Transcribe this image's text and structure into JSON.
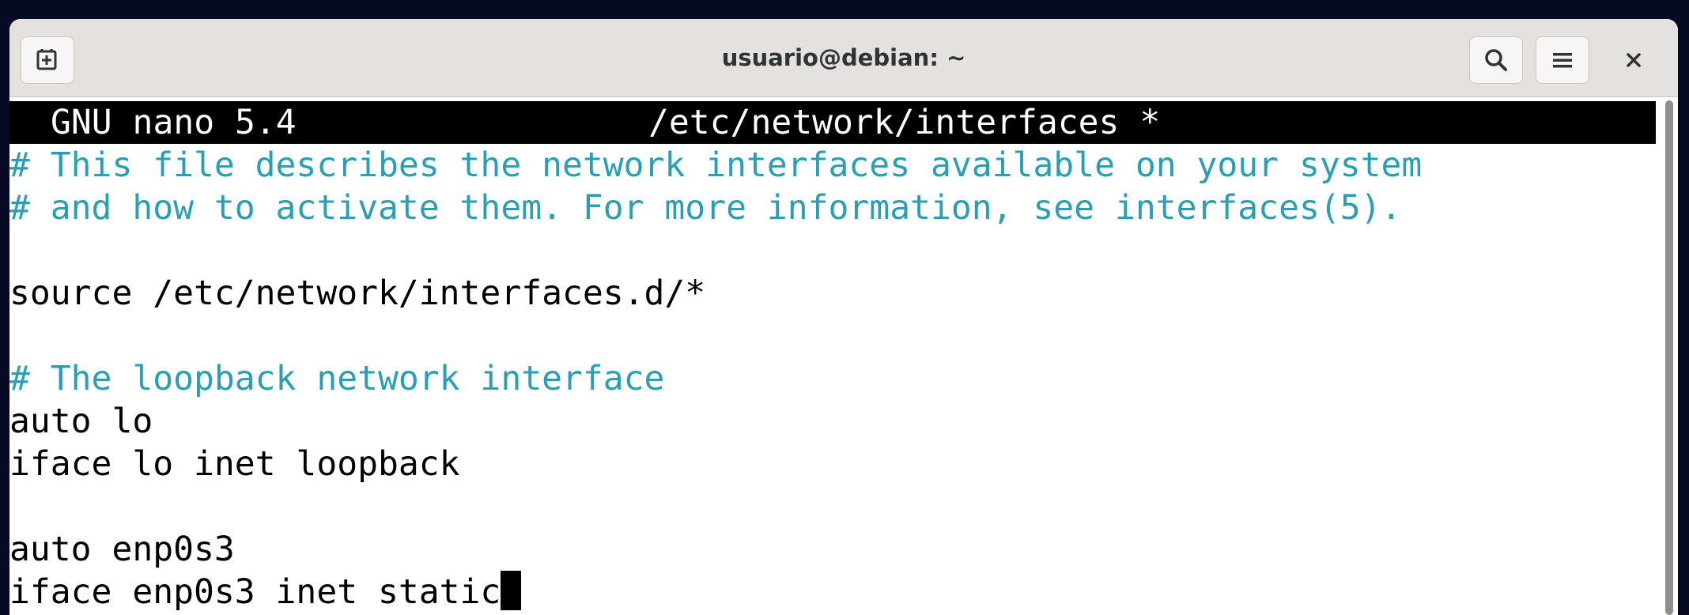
{
  "window": {
    "title": "usuario@debian: ~",
    "buttons": {
      "new_tab_icon": "new-tab-icon",
      "search_icon": "search-icon",
      "menu_icon": "hamburger-menu-icon",
      "close_icon": "close-icon"
    }
  },
  "nano": {
    "app_version": "GNU nano 5.4",
    "file_title": "/etc/network/interfaces *"
  },
  "editor_lines": [
    "# This file describes the network interfaces available on your system",
    "# and how to activate them. For more information, see interfaces(5).",
    "",
    "source /etc/network/interfaces.d/*",
    "",
    "# The loopback network interface",
    "auto lo",
    "iface lo inet loopback",
    "",
    "auto enp0s3",
    "iface enp0s3 inet static"
  ],
  "colors": {
    "comment": "#2a9fb3",
    "header_bg": "#000000",
    "header_fg": "#ffffff",
    "desktop_bg": "#060a22"
  }
}
